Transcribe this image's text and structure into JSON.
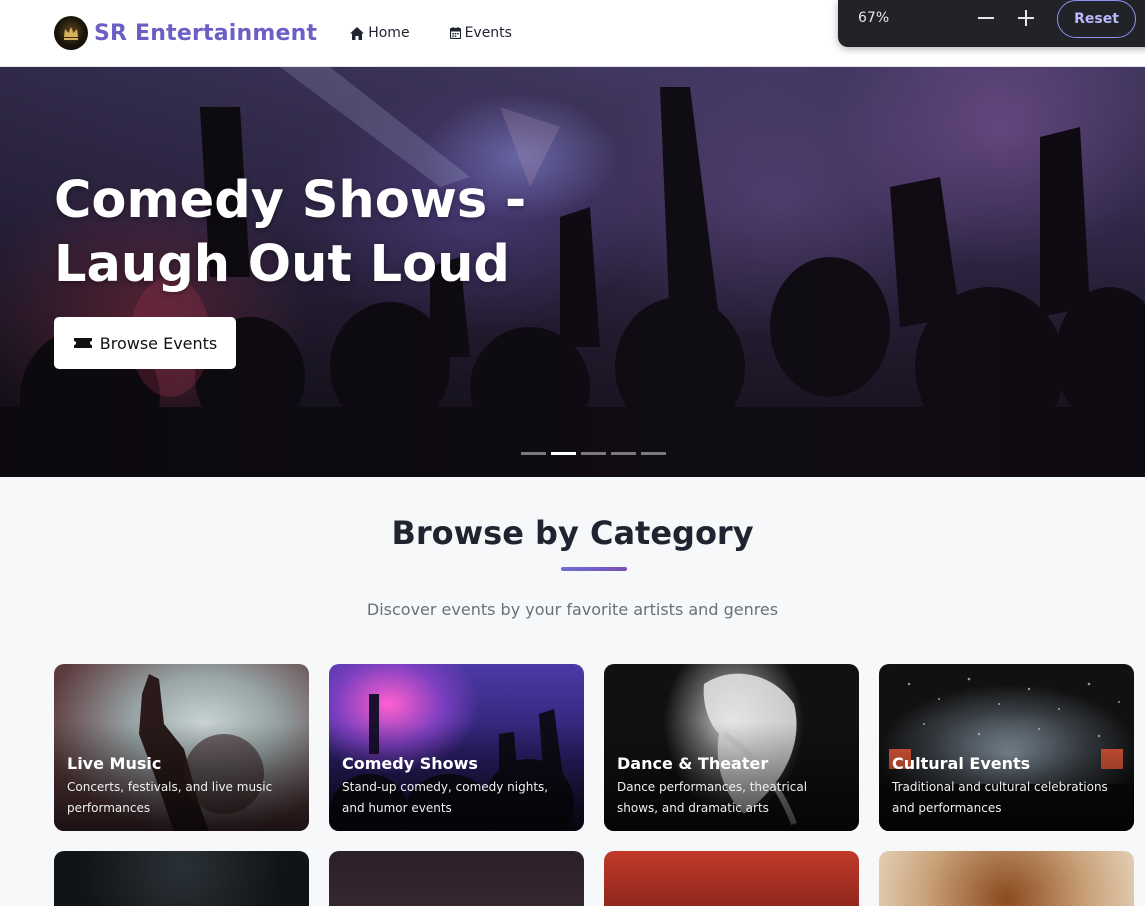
{
  "header": {
    "brand": "SR Entertainment",
    "logo_icon": "crown-logo-icon",
    "nav": [
      {
        "label": "Home",
        "icon": "home-icon"
      },
      {
        "label": "Events",
        "icon": "calendar-icon"
      }
    ]
  },
  "zoom": {
    "level": "67%",
    "minus_icon": "minus-icon",
    "plus_icon": "plus-icon",
    "reset_label": "Reset"
  },
  "hero": {
    "title": "Comedy Shows - Laugh Out Loud",
    "button_label": "Browse Events",
    "button_icon": "ticket-icon",
    "slide_count": 5,
    "active_slide": 2
  },
  "categories": {
    "title": "Browse by Category",
    "subtitle": "Discover events by your favorite artists and genres",
    "items": [
      {
        "title": "Live Music",
        "description": "Concerts, festivals, and live music performances"
      },
      {
        "title": "Comedy Shows",
        "description": "Stand-up comedy, comedy nights, and humor events"
      },
      {
        "title": "Dance & Theater",
        "description": "Dance performances, theatrical shows, and dramatic arts"
      },
      {
        "title": "Cultural Events",
        "description": "Traditional and cultural celebrations and performances"
      }
    ]
  },
  "colors": {
    "brand": "#6b5fc6",
    "accent_gradient_start": "#6b6fd6",
    "accent_gradient_end": "#7b4fb5"
  }
}
